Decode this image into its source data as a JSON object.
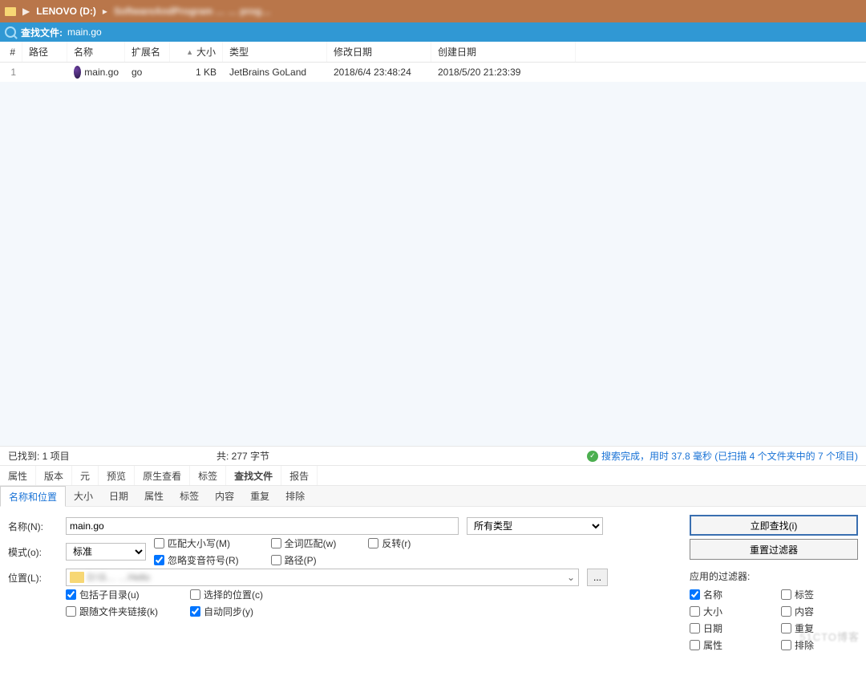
{
  "breadcrumb": {
    "drive": "LENOVO (D:)",
    "blurred": "SoftwareAndProgram … … prog…"
  },
  "searchBar": {
    "label": "查找文件:",
    "value": "main.go"
  },
  "columns": {
    "idx": "#",
    "path": "路径",
    "name": "名称",
    "ext": "扩展名",
    "size": "大小",
    "type": "类型",
    "mod": "修改日期",
    "create": "创建日期"
  },
  "rows": [
    {
      "idx": "1",
      "path": "",
      "name": "main.go",
      "ext": "go",
      "size": "1 KB",
      "type": "JetBrains GoLand",
      "mod": "2018/6/4 23:48:24",
      "create": "2018/5/20 21:23:39"
    }
  ],
  "status": {
    "found": "已找到:  1 项目",
    "total": "共: 277 字节",
    "done": "搜索完成，用时 37.8 毫秒 (已扫描 4 个文件夹中的 7 个项目)"
  },
  "tabs1": [
    "属性",
    "版本",
    "元",
    "预览",
    "原生查看",
    "标签",
    "查找文件",
    "报告"
  ],
  "tabs1_active": 6,
  "tabs2": [
    "名称和位置",
    "大小",
    "日期",
    "属性",
    "标签",
    "内容",
    "重复",
    "排除"
  ],
  "tabs2_active": 0,
  "form": {
    "nameLabel": "名称(N):",
    "nameValue": "main.go",
    "typeValue": "所有类型",
    "modeLabel": "模式(o):",
    "modeValue": "标准",
    "chk_matchCase": "匹配大小写(M)",
    "chk_wholeWord": "全词匹配(w)",
    "chk_invert": "反转(r)",
    "chk_ignoreDiac": "忽略变音符号(R)",
    "chk_path": "路径(P)",
    "locLabel": "位置(L):",
    "locValue": "D:\\S…                                               …Hello",
    "chk_subdirs": "包括子目录(u)",
    "chk_selLoc": "选择的位置(c)",
    "chk_followLinks": "跟随文件夹链接(k)",
    "chk_autoSync": "自动同步(y)"
  },
  "buttons": {
    "search": "立即查找(i)",
    "reset": "重置过滤器"
  },
  "filters": {
    "label": "应用的过滤器:",
    "items": [
      {
        "name": "名称",
        "checked": true
      },
      {
        "name": "标签",
        "checked": false
      },
      {
        "name": "大小",
        "checked": false
      },
      {
        "name": "内容",
        "checked": false
      },
      {
        "name": "日期",
        "checked": false
      },
      {
        "name": "重复",
        "checked": false
      },
      {
        "name": "属性",
        "checked": false
      },
      {
        "name": "排除",
        "checked": false
      }
    ]
  },
  "watermark": "51CTO博客"
}
